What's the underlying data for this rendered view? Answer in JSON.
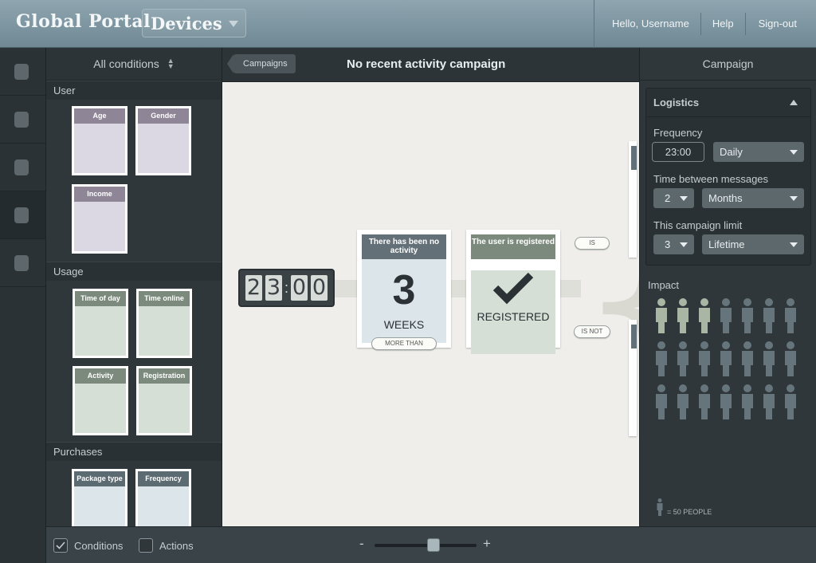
{
  "header": {
    "brand": "Global Portal",
    "section": "Devices",
    "greeting": "Hello, Username",
    "help": "Help",
    "signout": "Sign-out"
  },
  "conditions": {
    "filter": "All conditions",
    "groups": [
      {
        "title": "User",
        "cards": [
          "Age",
          "Gender",
          "Income"
        ]
      },
      {
        "title": "Usage",
        "cards": [
          "Time of day",
          "Time online",
          "Activity",
          "Registration"
        ]
      },
      {
        "title": "Purchases",
        "cards": [
          "Package type",
          "Frequency"
        ]
      }
    ]
  },
  "canvas": {
    "back": "Campaigns",
    "title": "No recent activity campaign",
    "clock": [
      "2",
      "3",
      "0",
      "0"
    ],
    "node1": {
      "head": "There has been no activity",
      "value": "3",
      "unit": "WEEKS",
      "tag": "MORE THAN"
    },
    "node2": {
      "head": "The user is registered",
      "label": "REGISTERED"
    },
    "branch_is": "IS",
    "branch_isnot": "IS NOT"
  },
  "campaign": {
    "title": "Campaign",
    "logistics": "Logistics",
    "frequency_label": "Frequency",
    "frequency_time": "23:00",
    "frequency_period": "Daily",
    "between_label": "Time between messages",
    "between_value": "2",
    "between_unit": "Months",
    "limit_label": "This campaign limit",
    "limit_value": "3",
    "limit_unit": "Lifetime",
    "impact": "Impact",
    "impact_highlighted": 3,
    "impact_total": 21,
    "legend": "= 50 PEOPLE",
    "colors": {
      "highlight": "#a9b6a3",
      "normal": "#66757c"
    }
  },
  "footer": {
    "conditions": "Conditions",
    "actions": "Actions",
    "minus": "-",
    "plus": "+",
    "zoom_level": 0.58
  }
}
